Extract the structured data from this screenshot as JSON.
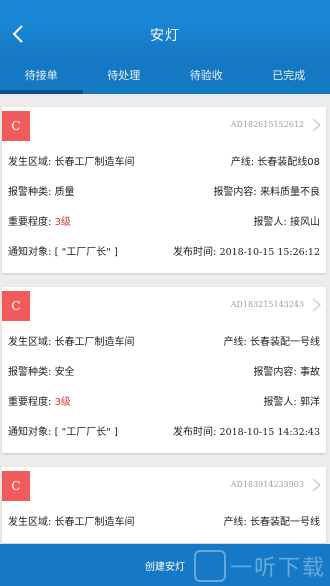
{
  "header": {
    "title": "安灯"
  },
  "tabs": [
    {
      "label": "待接单",
      "active": true
    },
    {
      "label": "待处理",
      "active": false
    },
    {
      "label": "待验收",
      "active": false
    },
    {
      "label": "已完成",
      "active": false
    }
  ],
  "cards": [
    {
      "badge": "C",
      "code": "AD182615152612",
      "area_label": "发生区域: ",
      "area": "长春工厂制造车间",
      "line_label": "产线: ",
      "line": "长春装配线08",
      "type_label": "报警种类: ",
      "type": "质量",
      "content_label": "报警内容: ",
      "content": "来料质量不良",
      "level_label": "重要程度: ",
      "level": "3级",
      "reporter_label": "报警人: ",
      "reporter": "接风山",
      "notify_label": "通知对象: ",
      "notify": "[ \"工厂厂长\" ]",
      "time_label": "发布时间: ",
      "time": "2018-10-15 15:26:12"
    },
    {
      "badge": "C",
      "code": "AD183215143243",
      "area_label": "发生区域: ",
      "area": "长春工厂制造车间",
      "line_label": "产线: ",
      "line": "长春装配一号线",
      "type_label": "报警种类: ",
      "type": "安全",
      "content_label": "报警内容: ",
      "content": "事故",
      "level_label": "重要程度: ",
      "level": "3级",
      "reporter_label": "报警人: ",
      "reporter": "郭洋",
      "notify_label": "通知对象: ",
      "notify": "[ \"工厂厂长\" ]",
      "time_label": "发布时间: ",
      "time": "2018-10-15 14:32:43"
    },
    {
      "badge": "C",
      "code": "AD183914233903",
      "area_label": "发生区域: ",
      "area": "长春工厂制造车间",
      "line_label": "产线: ",
      "line": "长春装配一号线"
    }
  ],
  "bottom": {
    "create_label": "创建安灯"
  },
  "watermark": {
    "text": "一听下载"
  },
  "colors": {
    "primary": "#1679c7",
    "badge": "#f25b5c",
    "level": "#e0393a"
  }
}
